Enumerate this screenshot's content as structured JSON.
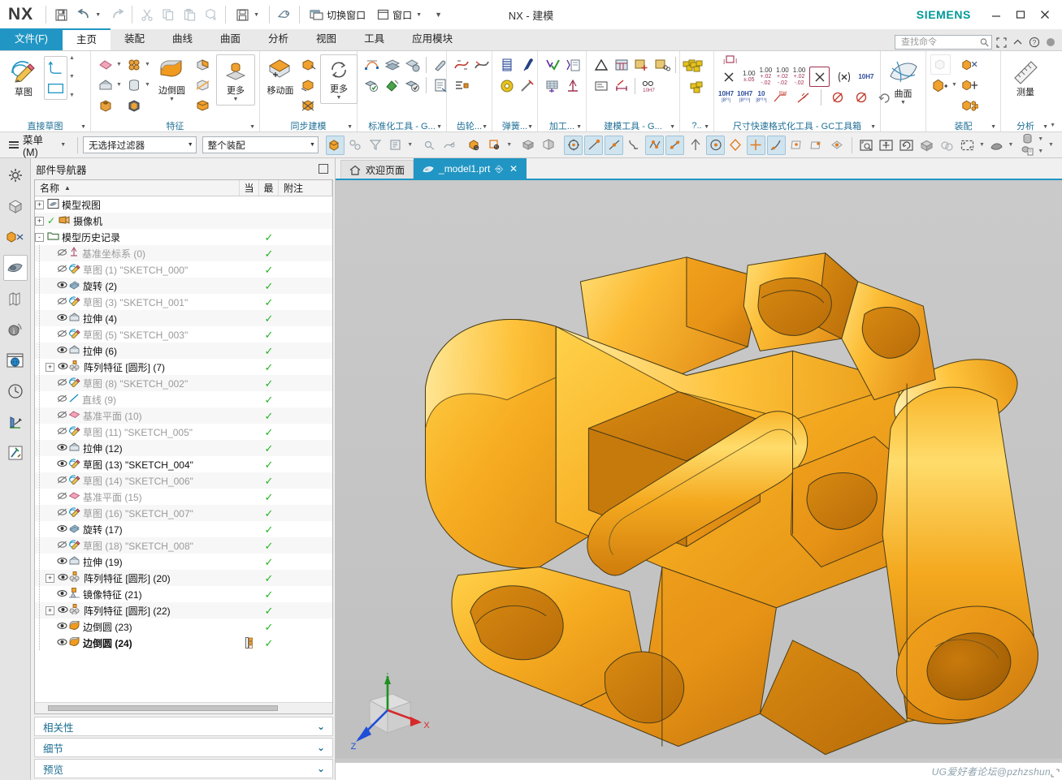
{
  "window": {
    "app_name": "NX",
    "title": "NX - 建模",
    "brand": "SIEMENS",
    "minimize": "—",
    "maximize": "▢",
    "close": "✕"
  },
  "quickaccess": {
    "items": [
      {
        "name": "save-icon",
        "label": "",
        "glyph": "save"
      },
      {
        "name": "undo-icon",
        "label": "",
        "glyph": "undo"
      },
      {
        "name": "redo-icon",
        "label": "",
        "glyph": "redo"
      },
      {
        "name": "cut-icon",
        "label": "",
        "glyph": "cut"
      },
      {
        "name": "copy-icon",
        "label": "",
        "glyph": "copy"
      },
      {
        "name": "paste-icon",
        "label": "",
        "glyph": "paste"
      },
      {
        "name": "paste-special-icon",
        "label": "",
        "glyph": "paste2"
      },
      {
        "name": "save-as-icon",
        "label": "",
        "glyph": "save2"
      },
      {
        "name": "eraser-icon",
        "label": "",
        "glyph": "eraser"
      }
    ],
    "switch_window_label": "切换窗口",
    "window_label": "窗口"
  },
  "ribbon": {
    "tabs": [
      {
        "label": "文件(F)",
        "kind": "file"
      },
      {
        "label": "主页",
        "kind": "active"
      },
      {
        "label": "装配",
        "kind": "normal"
      },
      {
        "label": "曲线",
        "kind": "normal"
      },
      {
        "label": "曲面",
        "kind": "normal"
      },
      {
        "label": "分析",
        "kind": "normal"
      },
      {
        "label": "视图",
        "kind": "normal"
      },
      {
        "label": "工具",
        "kind": "normal"
      },
      {
        "label": "应用模块",
        "kind": "normal"
      }
    ],
    "search": {
      "placeholder": "查找命令"
    },
    "groups": [
      {
        "name": "直接草图",
        "label": "直接草图",
        "big": [
          {
            "label": "草图",
            "icon": "sketch-icon"
          }
        ],
        "small": []
      },
      {
        "name": "特征",
        "label": "特征",
        "big": [
          {
            "label": "边倒圆",
            "icon": "edge-blend-icon"
          },
          {
            "label": "更多",
            "icon": "more-features-icon"
          }
        ],
        "small": []
      },
      {
        "name": "同步建模",
        "label": "同步建模",
        "big": [
          {
            "label": "移动面",
            "icon": "move-face-icon"
          },
          {
            "label": "更多",
            "icon": "more-sync-icon"
          }
        ],
        "small": []
      },
      {
        "name": "标准化工具",
        "label": "标准化工具 - G...",
        "big": [],
        "small": []
      },
      {
        "name": "齿轮",
        "label": "齿轮...",
        "big": [],
        "small": []
      },
      {
        "name": "弹簧",
        "label": "弹簧...",
        "big": [],
        "small": []
      },
      {
        "name": "加工",
        "label": "加工...",
        "big": [],
        "small": []
      },
      {
        "name": "建模工具",
        "label": "建模工具 - G...",
        "big": [],
        "small": []
      },
      {
        "name": "杂项",
        "label": "?..",
        "big": [],
        "small": []
      },
      {
        "name": "尺寸快速格式化工具",
        "label": "尺寸快速格式化工具 - GC工具箱",
        "big": [],
        "small": []
      },
      {
        "name": "曲面",
        "label": "",
        "big": [
          {
            "label": "曲面",
            "icon": "surface-icon"
          }
        ],
        "small": []
      },
      {
        "name": "装配",
        "label": "装配",
        "big": [],
        "small": []
      },
      {
        "name": "分析",
        "label": "分析",
        "big": [
          {
            "label": "测量",
            "icon": "measure-icon"
          }
        ],
        "small": []
      }
    ],
    "tolerance_labels": [
      "1.00",
      "1.00",
      "1.00",
      "1.00",
      "10H7",
      "10H7",
      "10H7",
      "10"
    ]
  },
  "selectionbar": {
    "menu_label": "菜单(M)",
    "filter_value": "无选择过滤器",
    "scope_value": "整个装配"
  },
  "navigator": {
    "title": "部件导航器",
    "columns": [
      {
        "label": "名称"
      },
      {
        "label": "当"
      },
      {
        "label": "最"
      },
      {
        "label": "附注"
      }
    ],
    "rows": [
      {
        "indent": 0,
        "expander": "+",
        "icon": "model-view-icon",
        "label": "模型视图",
        "dim": false,
        "check": false,
        "note": false,
        "bold": false
      },
      {
        "indent": 0,
        "expander": "+",
        "icon": "camera-icon",
        "label": "摄像机",
        "dim": false,
        "check": false,
        "note": false,
        "bold": false,
        "pre_check": true
      },
      {
        "indent": 0,
        "expander": "-",
        "icon": "folder-icon",
        "label": "模型历史记录",
        "dim": false,
        "check": true,
        "note": false,
        "bold": false
      },
      {
        "indent": 1,
        "expander": "",
        "icon": "hidden-datum-icon",
        "label": "基准坐标系 (0)",
        "dim": true,
        "check": true,
        "note": false,
        "bold": false
      },
      {
        "indent": 1,
        "expander": "",
        "icon": "hidden-sketch-icon",
        "label": "草图 (1) \"SKETCH_000\"",
        "dim": true,
        "check": true,
        "note": false,
        "bold": false
      },
      {
        "indent": 1,
        "expander": "",
        "icon": "revolve-icon",
        "label": "旋转 (2)",
        "dim": false,
        "check": true,
        "note": false,
        "bold": false
      },
      {
        "indent": 1,
        "expander": "",
        "icon": "hidden-sketch-icon",
        "label": "草图 (3) \"SKETCH_001\"",
        "dim": true,
        "check": true,
        "note": false,
        "bold": false
      },
      {
        "indent": 1,
        "expander": "",
        "icon": "extrude-icon",
        "label": "拉伸 (4)",
        "dim": false,
        "check": true,
        "note": false,
        "bold": false
      },
      {
        "indent": 1,
        "expander": "",
        "icon": "hidden-sketch-icon",
        "label": "草图 (5) \"SKETCH_003\"",
        "dim": true,
        "check": true,
        "note": false,
        "bold": false
      },
      {
        "indent": 1,
        "expander": "",
        "icon": "extrude-icon",
        "label": "拉伸 (6)",
        "dim": false,
        "check": true,
        "note": false,
        "bold": false
      },
      {
        "indent": 1,
        "expander": "+",
        "icon": "pattern-icon",
        "label": "阵列特征 [圆形] (7)",
        "dim": false,
        "check": true,
        "note": false,
        "bold": false
      },
      {
        "indent": 1,
        "expander": "",
        "icon": "hidden-sketch-icon",
        "label": "草图 (8) \"SKETCH_002\"",
        "dim": true,
        "check": true,
        "note": false,
        "bold": false
      },
      {
        "indent": 1,
        "expander": "",
        "icon": "line-icon",
        "label": "直线 (9)",
        "dim": true,
        "check": true,
        "note": false,
        "bold": false
      },
      {
        "indent": 1,
        "expander": "",
        "icon": "datum-plane-icon",
        "label": "基准平面 (10)",
        "dim": true,
        "check": true,
        "note": false,
        "bold": false
      },
      {
        "indent": 1,
        "expander": "",
        "icon": "hidden-sketch-icon",
        "label": "草图 (11) \"SKETCH_005\"",
        "dim": true,
        "check": true,
        "note": false,
        "bold": false
      },
      {
        "indent": 1,
        "expander": "",
        "icon": "extrude-icon",
        "label": "拉伸 (12)",
        "dim": false,
        "check": true,
        "note": false,
        "bold": false
      },
      {
        "indent": 1,
        "expander": "",
        "icon": "sketch-icon",
        "label": "草图 (13) \"SKETCH_004\"",
        "dim": false,
        "check": true,
        "note": false,
        "bold": false
      },
      {
        "indent": 1,
        "expander": "",
        "icon": "hidden-sketch-icon",
        "label": "草图 (14) \"SKETCH_006\"",
        "dim": true,
        "check": true,
        "note": false,
        "bold": false
      },
      {
        "indent": 1,
        "expander": "",
        "icon": "datum-plane-icon",
        "label": "基准平面 (15)",
        "dim": true,
        "check": true,
        "note": false,
        "bold": false
      },
      {
        "indent": 1,
        "expander": "",
        "icon": "hidden-sketch-icon",
        "label": "草图 (16) \"SKETCH_007\"",
        "dim": true,
        "check": true,
        "note": false,
        "bold": false
      },
      {
        "indent": 1,
        "expander": "",
        "icon": "revolve-icon",
        "label": "旋转 (17)",
        "dim": false,
        "check": true,
        "note": false,
        "bold": false
      },
      {
        "indent": 1,
        "expander": "",
        "icon": "hidden-sketch-icon",
        "label": "草图 (18) \"SKETCH_008\"",
        "dim": true,
        "check": true,
        "note": false,
        "bold": false
      },
      {
        "indent": 1,
        "expander": "",
        "icon": "extrude-icon",
        "label": "拉伸 (19)",
        "dim": false,
        "check": true,
        "note": false,
        "bold": false
      },
      {
        "indent": 1,
        "expander": "+",
        "icon": "pattern-icon",
        "label": "阵列特征 [圆形] (20)",
        "dim": false,
        "check": true,
        "note": false,
        "bold": false
      },
      {
        "indent": 1,
        "expander": "",
        "icon": "mirror-icon",
        "label": "镜像特征 (21)",
        "dim": false,
        "check": true,
        "note": false,
        "bold": false
      },
      {
        "indent": 1,
        "expander": "+",
        "icon": "pattern-icon",
        "label": "阵列特征 [圆形] (22)",
        "dim": false,
        "check": true,
        "note": false,
        "bold": false
      },
      {
        "indent": 1,
        "expander": "",
        "icon": "blend-icon",
        "label": "边倒圆 (23)",
        "dim": false,
        "check": true,
        "note": false,
        "bold": false
      },
      {
        "indent": 1,
        "expander": "",
        "icon": "blend-icon",
        "label": "边倒圆 (24)",
        "dim": false,
        "check": true,
        "note": true,
        "bold": true
      }
    ],
    "panels": [
      {
        "label": "相关性",
        "chevron": "⌄"
      },
      {
        "label": "细节",
        "chevron": "⌄"
      },
      {
        "label": "预览",
        "chevron": "⌄"
      }
    ]
  },
  "rail": {
    "items": [
      {
        "name": "assembly-navigator-rail",
        "icon": "gear-icon"
      },
      {
        "name": "part-navigator-rail",
        "icon": "cube-icon"
      },
      {
        "name": "constraint-navigator-rail",
        "icon": "constraint-icon"
      },
      {
        "name": "model-navigator-rail",
        "icon": "model-icon",
        "selected": true
      },
      {
        "name": "reuse-library-rail",
        "icon": "books-icon"
      },
      {
        "name": "hd3d-tools-rail",
        "icon": "info-icon"
      },
      {
        "name": "web-browser-rail",
        "icon": "globe-icon"
      },
      {
        "name": "history-rail",
        "icon": "clock-icon"
      },
      {
        "name": "process-studio-rail",
        "icon": "process-icon"
      },
      {
        "name": "roles-rail",
        "icon": "tools-icon"
      }
    ]
  },
  "documents": {
    "tabs": [
      {
        "label": "欢迎页面",
        "icon": "home-icon",
        "active": false,
        "closable": false
      },
      {
        "label": "_model1.prt",
        "icon": "part-icon",
        "active": true,
        "closable": true,
        "modified_glyph": "⎆",
        "close_glyph": "✕"
      }
    ]
  },
  "viewport": {
    "background_top": "#c8c8c8",
    "background_bottom": "#bfbfbf",
    "model_color": "#f5a623",
    "model_highlight": "#ffd34d",
    "model_shadow": "#d8851a",
    "edge_color": "#5a4a20",
    "triad": {
      "x_label": "X",
      "y_label": "Y",
      "z_label": "Z",
      "x_color": "#d62a2a",
      "y_color": "#1f9020",
      "z_color": "#1f4fd6"
    }
  },
  "statusbar": {
    "watermark": "UG爱好者论坛@pzhzshun"
  }
}
